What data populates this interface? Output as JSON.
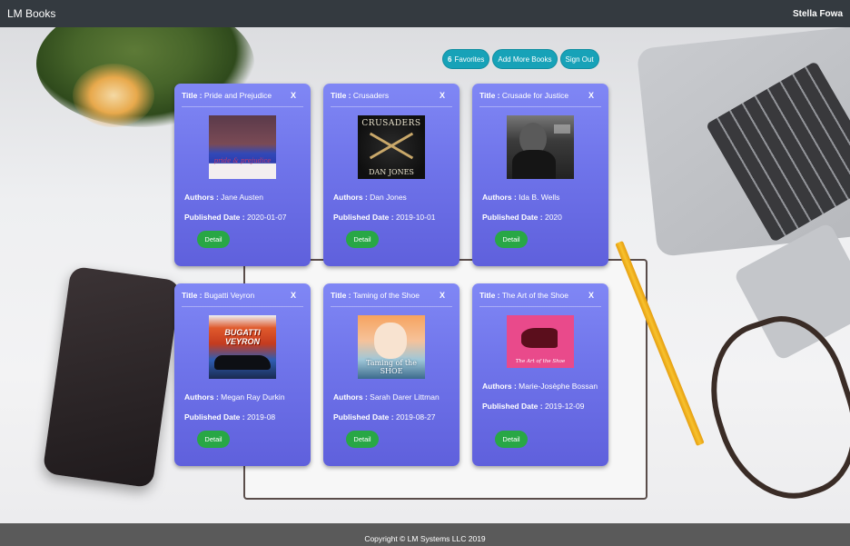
{
  "navbar": {
    "brand": "LM Books",
    "user": "Stella Fowa"
  },
  "actions": {
    "favorites_count": "6",
    "favorites_label": "Favorites",
    "add_more": "Add More Books",
    "sign_out": "Sign Out"
  },
  "labels": {
    "title": "Title :",
    "authors": "Authors :",
    "published": "Published Date :",
    "close": "X",
    "detail": "Detail"
  },
  "books": [
    {
      "title": "Pride and Prejudice",
      "authors": "Jane Austen",
      "published": "2020-01-07",
      "cover_text": "pride & prejudice"
    },
    {
      "title": "Crusaders",
      "authors": "Dan Jones",
      "published": "2019-10-01",
      "cover_text": "CRUSADERS",
      "cover_author": "DAN JONES"
    },
    {
      "title": "Crusade for Justice",
      "authors": "Ida B. Wells",
      "published": "2020"
    },
    {
      "title": "Bugatti Veyron",
      "authors": "Megan Ray Durkin",
      "published": "2019-08",
      "cover_text": "BUGATTI VEYRON"
    },
    {
      "title": "Taming of the Shoe",
      "authors": "Sarah Darer Littman",
      "published": "2019-08-27",
      "cover_text": "Taming of the SHOE"
    },
    {
      "title": "The Art of the Shoe",
      "authors": "Marie-Josèphe Bossan",
      "published": "2019-12-09",
      "cover_text": "The Art of the Shoe"
    }
  ],
  "footer": {
    "copyright": "Copyright © LM Systems LLC 2019"
  }
}
